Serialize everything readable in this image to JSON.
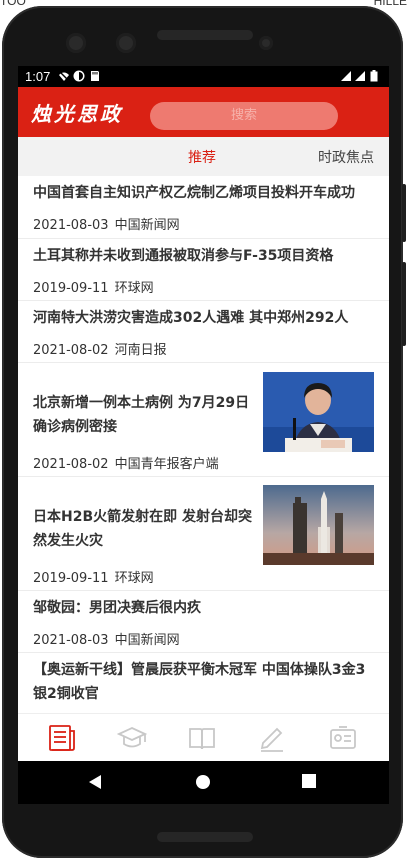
{
  "top_strip": {
    "left_text": "TOO",
    "right_text": "HILLE"
  },
  "status": {
    "time": "1:07"
  },
  "appbar": {
    "logo": "烛光思政",
    "search_placeholder": "搜索"
  },
  "tabs": [
    {
      "label": "推荐",
      "active": true
    },
    {
      "label": "时政焦点",
      "active": false
    }
  ],
  "news": [
    {
      "title": "中国首套自主知识产权乙烷制乙烯项目投料开车成功",
      "date": "2021-08-03",
      "source": "中国新闻网",
      "has_image": false
    },
    {
      "title": "土耳其称并未收到通报被取消参与F-35项目资格",
      "date": "2019-09-11",
      "source": "环球网",
      "has_image": false
    },
    {
      "title": "河南特大洪涝灾害造成302人遇难 其中郑州292人",
      "date": "2021-08-02",
      "source": "河南日报",
      "has_image": false
    },
    {
      "title_line1": "北京新增一例本土病例 为7月29日",
      "title_line2": "确诊病例密接",
      "date": "2021-08-02",
      "source": "中国青年报客户端",
      "has_image": true,
      "image": "press-conference-speaker"
    },
    {
      "title_line1": "日本H2B火箭发射在即 发射台却突",
      "title_line2": "然发生火灾",
      "date": "2019-09-11",
      "source": "环球网",
      "has_image": true,
      "image": "rocket-launch-pad"
    },
    {
      "title": "邹敬园：男团决赛后很内疚",
      "date": "2021-08-03",
      "source": "中国新闻网",
      "has_image": false
    },
    {
      "title_line1": "【奥运新干线】管晨辰获平衡木冠军 中国体操队3金3",
      "title_line2": "银2铜收官",
      "has_image": false
    }
  ],
  "bottom_nav": [
    {
      "icon": "news-icon",
      "active": true
    },
    {
      "icon": "graduation-cap-icon",
      "active": false
    },
    {
      "icon": "book-icon",
      "active": false
    },
    {
      "icon": "pencil-icon",
      "active": false
    },
    {
      "icon": "profile-card-icon",
      "active": false
    }
  ],
  "colors": {
    "brand_red": "#da2114",
    "nav_inactive": "#c8c8c8"
  }
}
